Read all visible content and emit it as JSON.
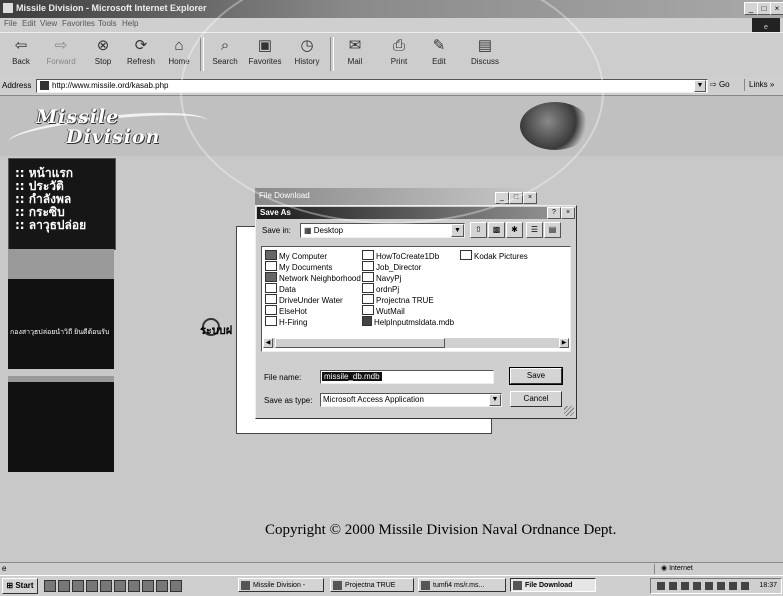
{
  "window": {
    "title": "Missile Division - Microsoft Internet Explorer",
    "controls": [
      "_",
      "□",
      "×"
    ]
  },
  "menubar": {
    "items": [
      "File",
      "Edit",
      "View",
      "Favorites",
      "Tools",
      "Help"
    ]
  },
  "toolbar": {
    "buttons": [
      {
        "label": "Back",
        "icon": "back-arrow-icon"
      },
      {
        "label": "Forward",
        "icon": "forward-arrow-icon"
      },
      {
        "label": "Stop",
        "icon": "stop-icon"
      },
      {
        "label": "Refresh",
        "icon": "refresh-icon"
      },
      {
        "label": "Home",
        "icon": "home-icon"
      },
      {
        "label": "Search",
        "icon": "search-icon"
      },
      {
        "label": "Favorites",
        "icon": "favorites-icon"
      },
      {
        "label": "History",
        "icon": "history-icon"
      },
      {
        "label": "Mail",
        "icon": "mail-icon"
      },
      {
        "label": "Print",
        "icon": "print-icon"
      },
      {
        "label": "Edit",
        "icon": "edit-icon"
      },
      {
        "label": "Discuss",
        "icon": "discuss-icon"
      }
    ]
  },
  "address": {
    "label": "Address",
    "url": "http://www.missile.ord/kasab.php",
    "go_label": "Go",
    "links_label": "Links »"
  },
  "page": {
    "logo_line1": "Missile",
    "logo_line2": "Division",
    "nav_items": [
      ":: หน้าแรก",
      ":: ประวัติ",
      ":: กำลังพล",
      ":: กระซิบ",
      ":: ลาวุธปล่อย"
    ],
    "left_box_text": "กองสาวุธปล่อยนำวิถี ยินดีต้อนรับ",
    "main_heading_fragment": "ระบบฝ",
    "copyright": "Copyright © 2000 Missile Division Naval Ordnance Dept."
  },
  "file_download_dialog": {
    "title": "File Download"
  },
  "save_as_dialog": {
    "title": "Save As",
    "title_buttons": [
      "?",
      "×"
    ],
    "save_in_label": "Save in:",
    "save_in_value": "Desktop",
    "files": [
      {
        "name": "My Computer",
        "kind": "system"
      },
      {
        "name": "My Documents",
        "kind": "folder"
      },
      {
        "name": "Network Neighborhood",
        "kind": "system"
      },
      {
        "name": "Data",
        "kind": "folder"
      },
      {
        "name": "DriveUnder Water",
        "kind": "folder"
      },
      {
        "name": "ElseHot",
        "kind": "folder"
      },
      {
        "name": "H-Firing",
        "kind": "folder"
      },
      {
        "name": "HowToCreate1Db",
        "kind": "folder"
      },
      {
        "name": "Job_Director",
        "kind": "folder"
      },
      {
        "name": "NavyPj",
        "kind": "folder"
      },
      {
        "name": "ordnPj",
        "kind": "folder"
      },
      {
        "name": "Projectna TRUE",
        "kind": "folder"
      },
      {
        "name": "WutMail",
        "kind": "folder"
      },
      {
        "name": "HelpInputmsldata.mdb",
        "kind": "db"
      },
      {
        "name": "Kodak Pictures",
        "kind": "folder"
      }
    ],
    "file_name_label": "File name:",
    "file_name_value": "missile_db.mdb",
    "save_as_type_label": "Save as type:",
    "save_as_type_value": "Microsoft Access Application",
    "save_button": "Save",
    "cancel_button": "Cancel"
  },
  "statusbar": {
    "zone": "Internet"
  },
  "taskbar": {
    "start_label": "Start",
    "tasks": [
      {
        "label": "Missile Division -",
        "active": false
      },
      {
        "label": "Projectna TRUE",
        "active": false
      },
      {
        "label": "tumfi4 ms/r.ms...",
        "active": false
      },
      {
        "label": "File Download",
        "active": true
      }
    ],
    "clock": "18:37"
  }
}
